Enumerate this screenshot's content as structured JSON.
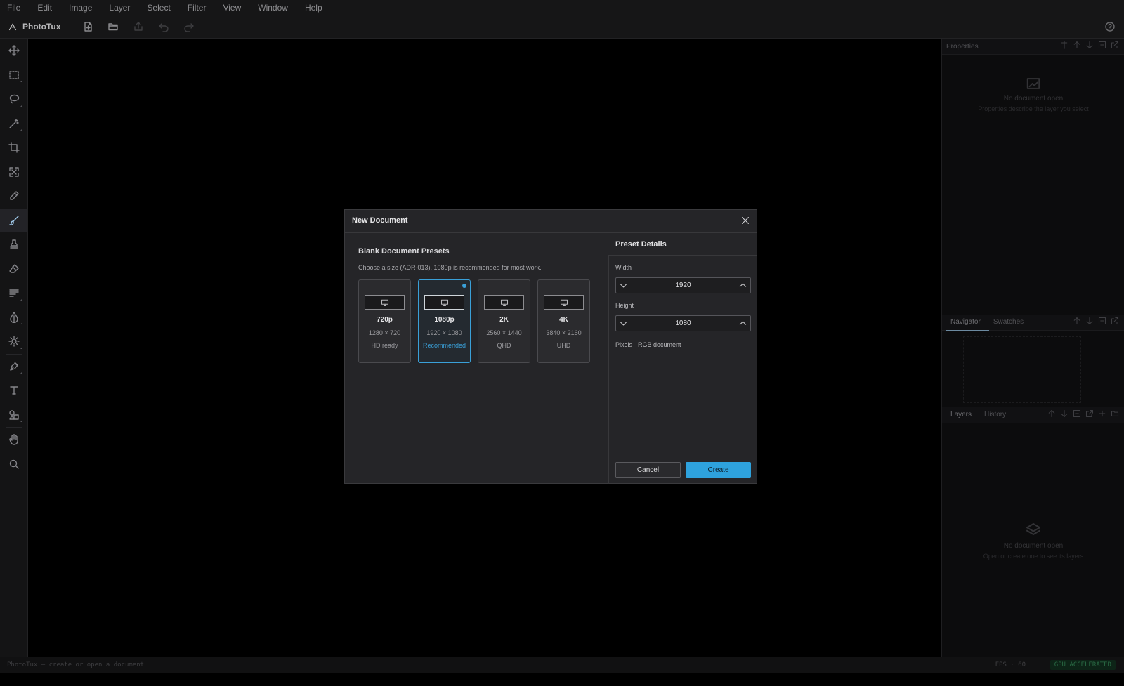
{
  "app": {
    "name": "PhotoTux"
  },
  "menu": [
    "File",
    "Edit",
    "Image",
    "Layer",
    "Select",
    "Filter",
    "View",
    "Window",
    "Help"
  ],
  "toolbar": {
    "buttons": [
      {
        "icon": "new-file-icon"
      },
      {
        "icon": "open-folder-icon"
      },
      {
        "icon": "export-icon"
      },
      {
        "icon": "undo-icon"
      },
      {
        "icon": "redo-icon"
      }
    ],
    "help_icon": "help-icon"
  },
  "tools": [
    "move-tool",
    "marquee-tool",
    "lasso-tool",
    "magic-wand-tool",
    "crop-tool",
    "transform-tool",
    "eyedropper-tool",
    "brush-tool",
    "stamp-tool",
    "eraser-tool",
    "gradient-tool",
    "blur-tool",
    "dodge-tool",
    "pen-tool",
    "text-tool",
    "shape-tool",
    "hand-tool",
    "zoom-tool"
  ],
  "panels": {
    "properties": {
      "title": "Properties",
      "empty_title": "No document open",
      "empty_sub": "Properties describe the layer you select"
    },
    "navigator": {
      "tabs": [
        "Navigator",
        "Swatches"
      ]
    },
    "layers": {
      "tabs": [
        "Layers",
        "History"
      ],
      "empty_title": "No document open",
      "empty_sub": "Open or create one to see its layers"
    }
  },
  "status": {
    "left": "PhotoTux — create or open a document",
    "fps_label": "FPS",
    "fps_value": "60",
    "gpu": "GPU ACCELERATED"
  },
  "dialog": {
    "title": "New Document",
    "presets_title": "Blank Document Presets",
    "presets_desc": "Choose a size (ADR-013). 1080p is recommended for most work.",
    "presets": [
      {
        "name": "720p",
        "res": "1280 × 720",
        "note": "HD ready",
        "selected": false
      },
      {
        "name": "1080p",
        "res": "1920 × 1080",
        "note": "Recommended",
        "selected": true
      },
      {
        "name": "2K",
        "res": "2560 × 1440",
        "note": "QHD",
        "selected": false
      },
      {
        "name": "4K",
        "res": "3840 × 2160",
        "note": "UHD",
        "selected": false
      }
    ],
    "details_title": "Preset Details",
    "width_label": "Width",
    "width_value": "1920",
    "height_label": "Height",
    "height_value": "1080",
    "hint": "Pixels · RGB document",
    "cancel": "Cancel",
    "create": "Create"
  },
  "colors": {
    "accent": "#2ea2dd",
    "background": "#000000",
    "dialog": "#252528"
  }
}
